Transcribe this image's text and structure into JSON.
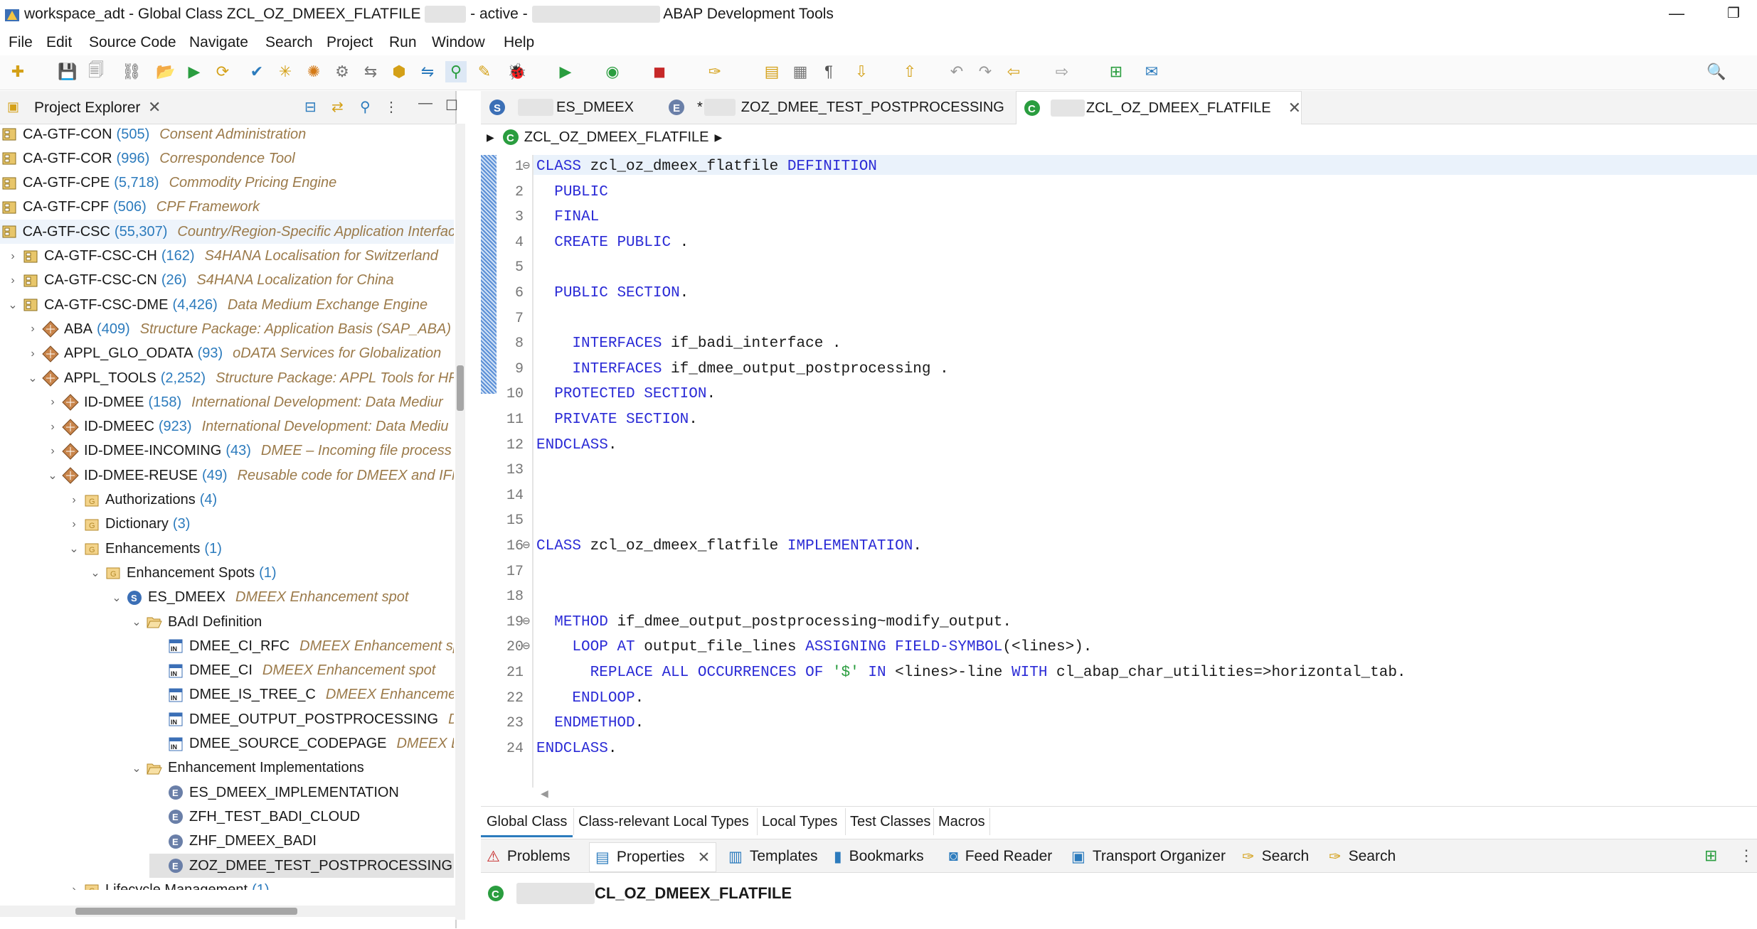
{
  "window": {
    "title_prefix": "workspace_adt - Global Class ZCL_OZ_DMEEX_FLATFILE",
    "title_mid": "- active -",
    "title_suffix": "ABAP Development Tools"
  },
  "menu": [
    "File",
    "Edit",
    "Source Code",
    "Navigate",
    "Search",
    "Project",
    "Run",
    "Window",
    "Help"
  ],
  "project_explorer": {
    "title": "Project Explorer",
    "items": [
      {
        "name": "CA-GTF-CON",
        "count": "(505)",
        "desc": "Consent Administration",
        "level": 0,
        "arrow": "",
        "icon": "package-icon"
      },
      {
        "name": "CA-GTF-COR",
        "count": "(996)",
        "desc": "Correspondence Tool",
        "level": 0,
        "arrow": "",
        "icon": "package-icon"
      },
      {
        "name": "CA-GTF-CPE",
        "count": "(5,718)",
        "desc": "Commodity Pricing Engine",
        "level": 0,
        "arrow": "",
        "icon": "package-icon"
      },
      {
        "name": "CA-GTF-CPF",
        "count": "(506)",
        "desc": "CPF Framework",
        "level": 0,
        "arrow": "",
        "icon": "package-icon"
      },
      {
        "name": "CA-GTF-CSC",
        "count": "(55,307)",
        "desc": "Country/Region-Specific Application Interfac",
        "level": 0,
        "arrow": "",
        "icon": "package-icon",
        "selected": true
      },
      {
        "name": "CA-GTF-CSC-CH",
        "count": "(162)",
        "desc": "S4HANA Localisation for Switzerland",
        "level": 1,
        "arrow": "›",
        "icon": "package-icon"
      },
      {
        "name": "CA-GTF-CSC-CN",
        "count": "(26)",
        "desc": "S4HANA Localization for China",
        "level": 1,
        "arrow": "›",
        "icon": "package-icon"
      },
      {
        "name": "CA-GTF-CSC-DME",
        "count": "(4,426)",
        "desc": "Data Medium Exchange Engine",
        "level": 1,
        "arrow": "⌄",
        "icon": "package-icon"
      },
      {
        "name": "ABA",
        "count": "(409)",
        "desc": "Structure Package: Application Basis (SAP_ABA)",
        "level": 2,
        "arrow": "›",
        "icon": "structure-package-icon"
      },
      {
        "name": "APPL_GLO_ODATA",
        "count": "(93)",
        "desc": "oDATA Services for Globalization",
        "level": 2,
        "arrow": "›",
        "icon": "structure-package-icon"
      },
      {
        "name": "APPL_TOOLS",
        "count": "(2,252)",
        "desc": "Structure Package: APPL Tools for HR",
        "level": 2,
        "arrow": "⌄",
        "icon": "structure-package-icon"
      },
      {
        "name": "ID-DMEE",
        "count": "(158)",
        "desc": "International Development: Data Mediur",
        "level": 3,
        "arrow": "›",
        "icon": "structure-package-icon"
      },
      {
        "name": "ID-DMEEC",
        "count": "(923)",
        "desc": "International Development: Data Mediu",
        "level": 3,
        "arrow": "›",
        "icon": "structure-package-icon"
      },
      {
        "name": "ID-DMEE-INCOMING",
        "count": "(43)",
        "desc": "DMEE – Incoming file process",
        "level": 3,
        "arrow": "›",
        "icon": "structure-package-icon"
      },
      {
        "name": "ID-DMEE-REUSE",
        "count": "(49)",
        "desc": "Reusable code for DMEEX and IFM",
        "level": 3,
        "arrow": "⌄",
        "icon": "structure-package-icon"
      },
      {
        "name": "Authorizations",
        "count": "(4)",
        "desc": "",
        "level": 4,
        "arrow": "›",
        "icon": "folder-icon"
      },
      {
        "name": "Dictionary",
        "count": "(3)",
        "desc": "",
        "level": 4,
        "arrow": "›",
        "icon": "folder-icon"
      },
      {
        "name": "Enhancements",
        "count": "(1)",
        "desc": "",
        "level": 4,
        "arrow": "⌄",
        "icon": "folder-icon"
      },
      {
        "name": "Enhancement Spots",
        "count": "(1)",
        "desc": "",
        "level": 5,
        "arrow": "⌄",
        "icon": "folder-icon"
      },
      {
        "name": "ES_DMEEX",
        "count": "",
        "desc": "DMEEX Enhancement spot",
        "level": 6,
        "arrow": "⌄",
        "icon": "spot-icon"
      },
      {
        "name": "BAdI Definition",
        "count": "",
        "desc": "",
        "level": 7,
        "arrow": "⌄",
        "icon": "open-folder-icon"
      },
      {
        "name": "DMEE_CI_RFC",
        "count": "",
        "desc": "DMEEX Enhancement spo",
        "level": 8,
        "arrow": "",
        "icon": "interface-icon"
      },
      {
        "name": "DMEE_CI",
        "count": "",
        "desc": "DMEEX Enhancement spot",
        "level": 8,
        "arrow": "",
        "icon": "interface-icon"
      },
      {
        "name": "DMEE_IS_TREE_C",
        "count": "",
        "desc": "DMEEX Enhancement",
        "level": 8,
        "arrow": "",
        "icon": "interface-icon"
      },
      {
        "name": "DMEE_OUTPUT_POSTPROCESSING",
        "count": "",
        "desc": "DM",
        "level": 8,
        "arrow": "",
        "icon": "interface-icon"
      },
      {
        "name": "DMEE_SOURCE_CODEPAGE",
        "count": "",
        "desc": "DMEEX Enh",
        "level": 8,
        "arrow": "",
        "icon": "interface-icon"
      },
      {
        "name": "Enhancement Implementations",
        "count": "",
        "desc": "",
        "level": 7,
        "arrow": "⌄",
        "icon": "open-folder-icon"
      },
      {
        "name": "ES_DMEEX_IMPLEMENTATION",
        "count": "",
        "desc": "",
        "level": 8,
        "arrow": "",
        "icon": "implementation-icon"
      },
      {
        "name": "ZFH_TEST_BADI_CLOUD",
        "count": "",
        "desc": "",
        "level": 8,
        "arrow": "",
        "icon": "implementation-icon"
      },
      {
        "name": "ZHF_DMEEX_BADI",
        "count": "",
        "desc": "",
        "level": 8,
        "arrow": "",
        "icon": "implementation-icon"
      },
      {
        "name": "ZOZ_DMEE_TEST_POSTPROCESSING",
        "count": "",
        "desc": "",
        "level": 8,
        "arrow": "",
        "icon": "implementation-icon",
        "highlight": true
      },
      {
        "name": "Lifecycle Management",
        "count": "(1)",
        "desc": "",
        "level": 4,
        "arrow": "›",
        "icon": "folder-icon"
      }
    ]
  },
  "editor_tabs": [
    {
      "label": "ES_DMEEX",
      "icon": "spot-icon"
    },
    {
      "label": "ZOZ_DMEE_TEST_POSTPROCESSING",
      "icon": "implementation-icon",
      "dirty": "*"
    },
    {
      "label": "ZCL_OZ_DMEEX_FLATFILE",
      "icon": "class-icon",
      "active": true
    }
  ],
  "breadcrumb": "ZCL_OZ_DMEEX_FLATFILE",
  "code_lines": [
    "CLASS zcl_oz_dmeex_flatfile DEFINITION",
    "  PUBLIC",
    "  FINAL",
    "  CREATE PUBLIC .",
    "",
    "  PUBLIC SECTION.",
    "",
    "    INTERFACES if_badi_interface .",
    "    INTERFACES if_dmee_output_postprocessing .",
    "  PROTECTED SECTION.",
    "  PRIVATE SECTION.",
    "ENDCLASS.",
    "",
    "",
    "",
    "CLASS zcl_oz_dmeex_flatfile IMPLEMENTATION.",
    "",
    "",
    "  METHOD if_dmee_output_postprocessing~modify_output.",
    "    LOOP AT output_file_lines ASSIGNING FIELD-SYMBOL(<lines>).",
    "      REPLACE ALL OCCURRENCES OF '$' IN <lines>-line WITH cl_abap_char_utilities=>horizontal_tab.",
    "    ENDLOOP.",
    "  ENDMETHOD.",
    "ENDCLASS."
  ],
  "editor_bottom_tabs": [
    "Global Class",
    "Class-relevant Local Types",
    "Local Types",
    "Test Classes",
    "Macros"
  ],
  "views": [
    "Problems",
    "Properties",
    "Templates",
    "Bookmarks",
    "Feed Reader",
    "Transport Organizer",
    "Search",
    "Search"
  ],
  "properties_title": "CL_OZ_DMEEX_FLATFILE",
  "colors": {
    "keyword": "#2b2bd6",
    "string": "#2a9d3f",
    "count": "#2c7bbd",
    "description": "#9b7a4a"
  }
}
